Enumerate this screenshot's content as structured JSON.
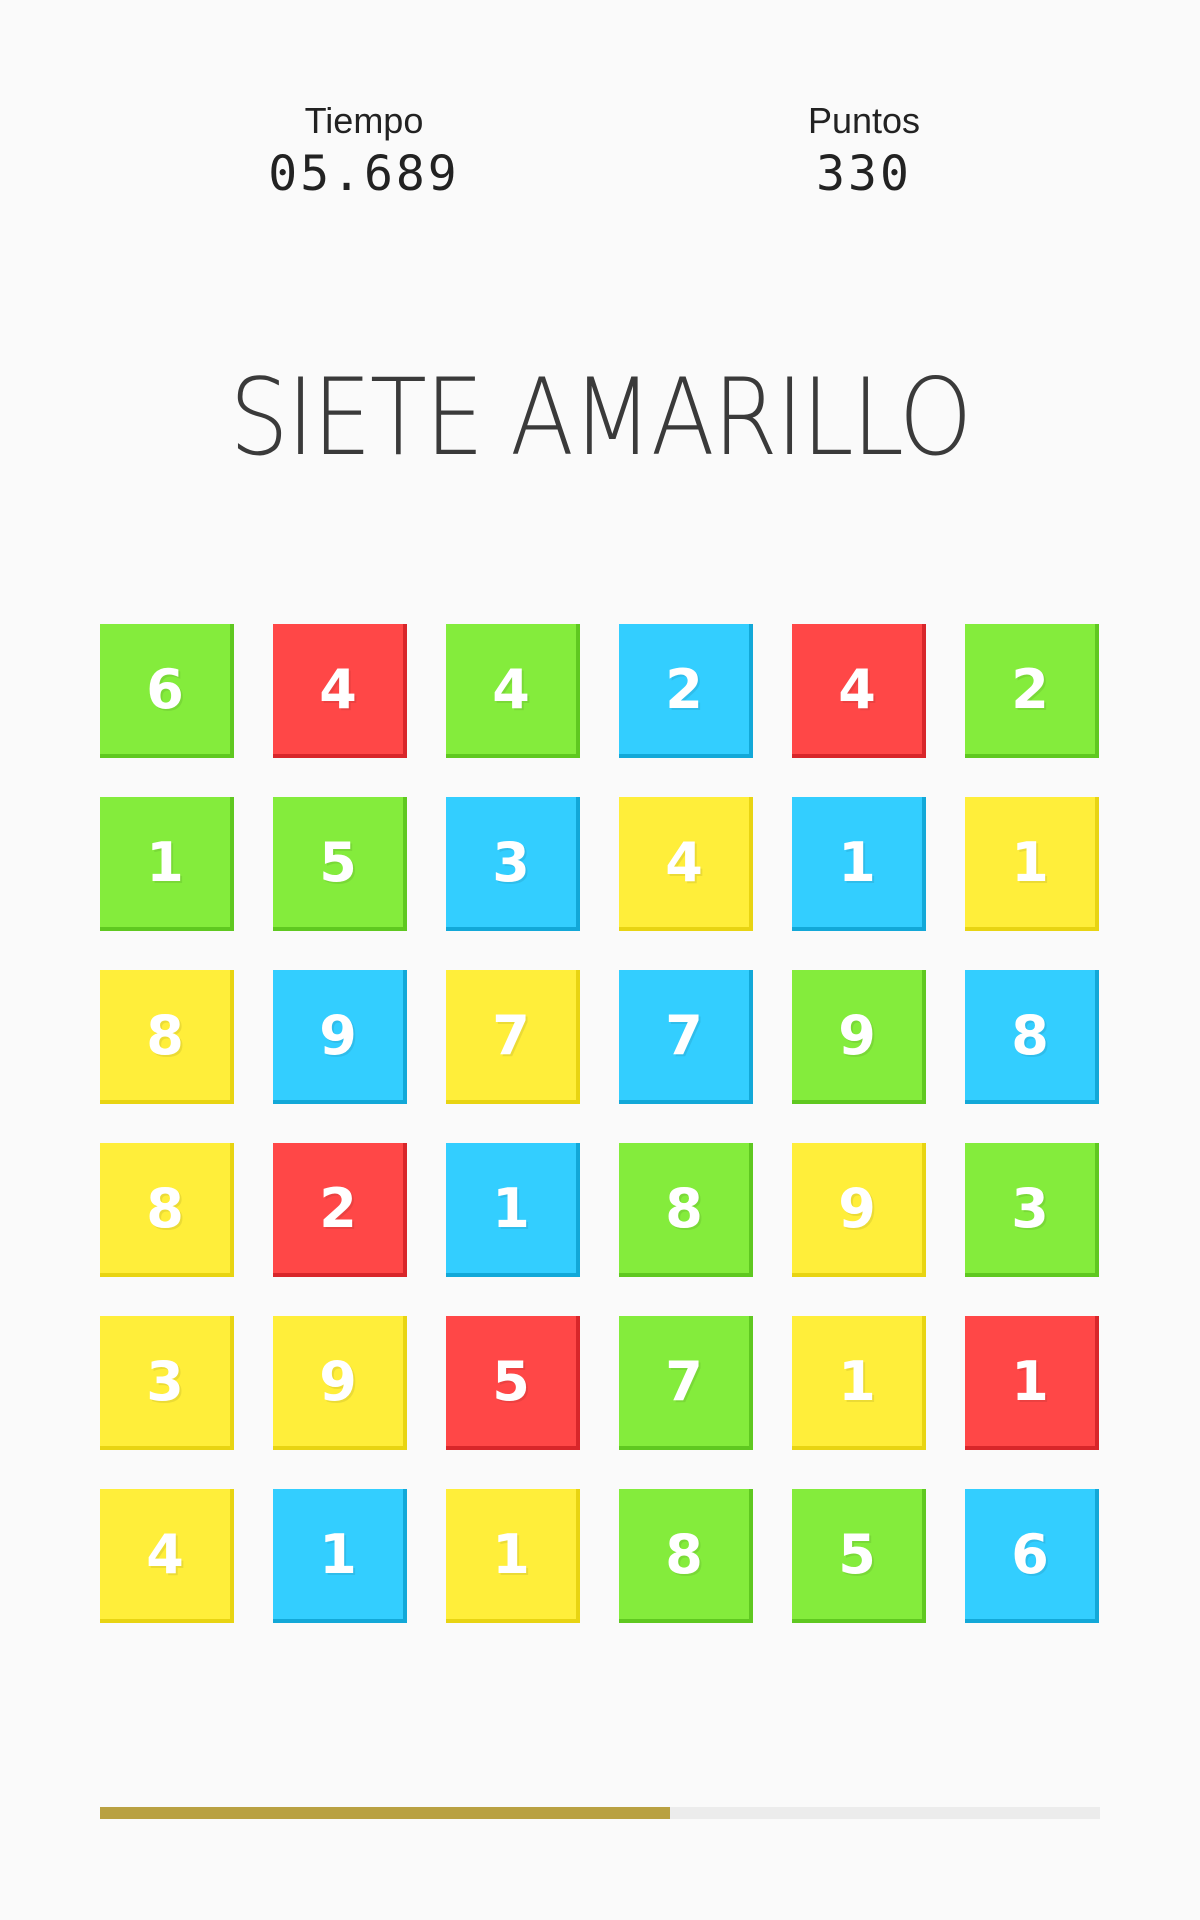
{
  "stats": {
    "time_label": "Tiempo",
    "time_value": "05.689",
    "points_label": "Puntos",
    "points_value": "330"
  },
  "target": {
    "text": "SIETE AMARILLO"
  },
  "grid": {
    "columns": 6,
    "tiles": [
      {
        "value": "6",
        "color": "green"
      },
      {
        "value": "4",
        "color": "red"
      },
      {
        "value": "4",
        "color": "green"
      },
      {
        "value": "2",
        "color": "blue"
      },
      {
        "value": "4",
        "color": "red"
      },
      {
        "value": "2",
        "color": "green"
      },
      {
        "value": "1",
        "color": "green"
      },
      {
        "value": "5",
        "color": "green"
      },
      {
        "value": "3",
        "color": "blue"
      },
      {
        "value": "4",
        "color": "yellow"
      },
      {
        "value": "1",
        "color": "blue"
      },
      {
        "value": "1",
        "color": "yellow"
      },
      {
        "value": "8",
        "color": "yellow"
      },
      {
        "value": "9",
        "color": "blue"
      },
      {
        "value": "7",
        "color": "yellow"
      },
      {
        "value": "7",
        "color": "blue"
      },
      {
        "value": "9",
        "color": "green"
      },
      {
        "value": "8",
        "color": "blue"
      },
      {
        "value": "8",
        "color": "yellow"
      },
      {
        "value": "2",
        "color": "red"
      },
      {
        "value": "1",
        "color": "blue"
      },
      {
        "value": "8",
        "color": "green"
      },
      {
        "value": "9",
        "color": "yellow"
      },
      {
        "value": "3",
        "color": "green"
      },
      {
        "value": "3",
        "color": "yellow"
      },
      {
        "value": "9",
        "color": "yellow"
      },
      {
        "value": "5",
        "color": "red"
      },
      {
        "value": "7",
        "color": "green"
      },
      {
        "value": "1",
        "color": "yellow"
      },
      {
        "value": "1",
        "color": "red"
      },
      {
        "value": "4",
        "color": "yellow"
      },
      {
        "value": "1",
        "color": "blue"
      },
      {
        "value": "1",
        "color": "yellow"
      },
      {
        "value": "8",
        "color": "green"
      },
      {
        "value": "5",
        "color": "green"
      },
      {
        "value": "6",
        "color": "blue"
      }
    ]
  },
  "colors": {
    "green": "#84ec3c",
    "red": "#ff4747",
    "blue": "#33ceff",
    "yellow": "#ffee3a",
    "progress": "#b9a142",
    "track": "#ececec"
  },
  "progress": {
    "fraction": 0.57
  }
}
